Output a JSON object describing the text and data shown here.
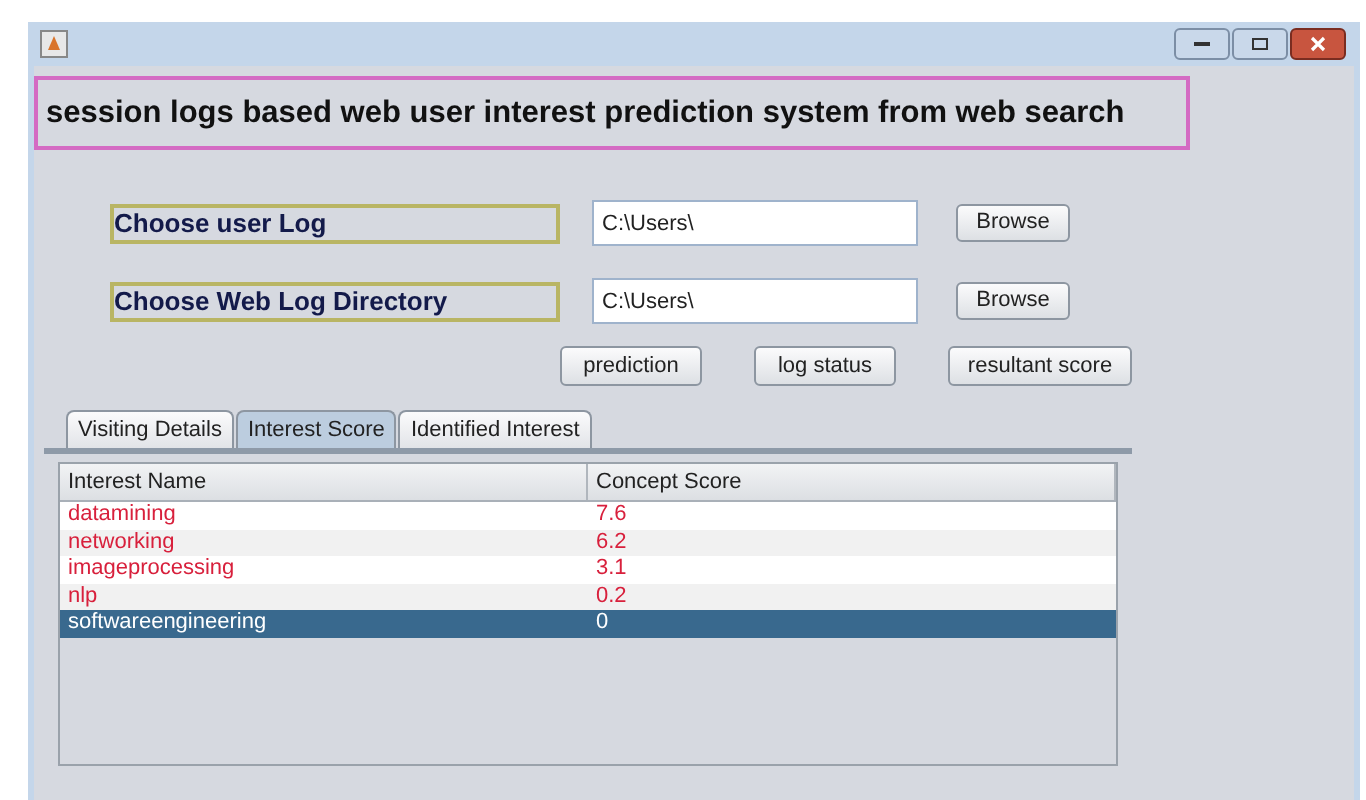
{
  "heading": "session logs based web user interest prediction system from web search",
  "inputs": [
    {
      "label": "Choose user Log",
      "value": "C:\\Users\\",
      "button": "Browse"
    },
    {
      "label": "Choose Web Log Directory",
      "value": "C:\\Users\\",
      "button": "Browse"
    }
  ],
  "actions": [
    "prediction",
    "log status",
    "resultant score"
  ],
  "tabs": [
    {
      "label": "Visiting Details",
      "selected": false
    },
    {
      "label": "Interest Score",
      "selected": true
    },
    {
      "label": "Identified Interest",
      "selected": false
    }
  ],
  "table": {
    "columns": [
      "Interest Name",
      "Concept Score"
    ],
    "rows": [
      {
        "cells": [
          "datamining",
          "7.6"
        ],
        "selected": false
      },
      {
        "cells": [
          "networking",
          "6.2"
        ],
        "selected": false
      },
      {
        "cells": [
          "imageprocessing",
          "3.1"
        ],
        "selected": false
      },
      {
        "cells": [
          "nlp",
          "0.2"
        ],
        "selected": false
      },
      {
        "cells": [
          "softwareengineering",
          "0"
        ],
        "selected": true
      }
    ]
  }
}
